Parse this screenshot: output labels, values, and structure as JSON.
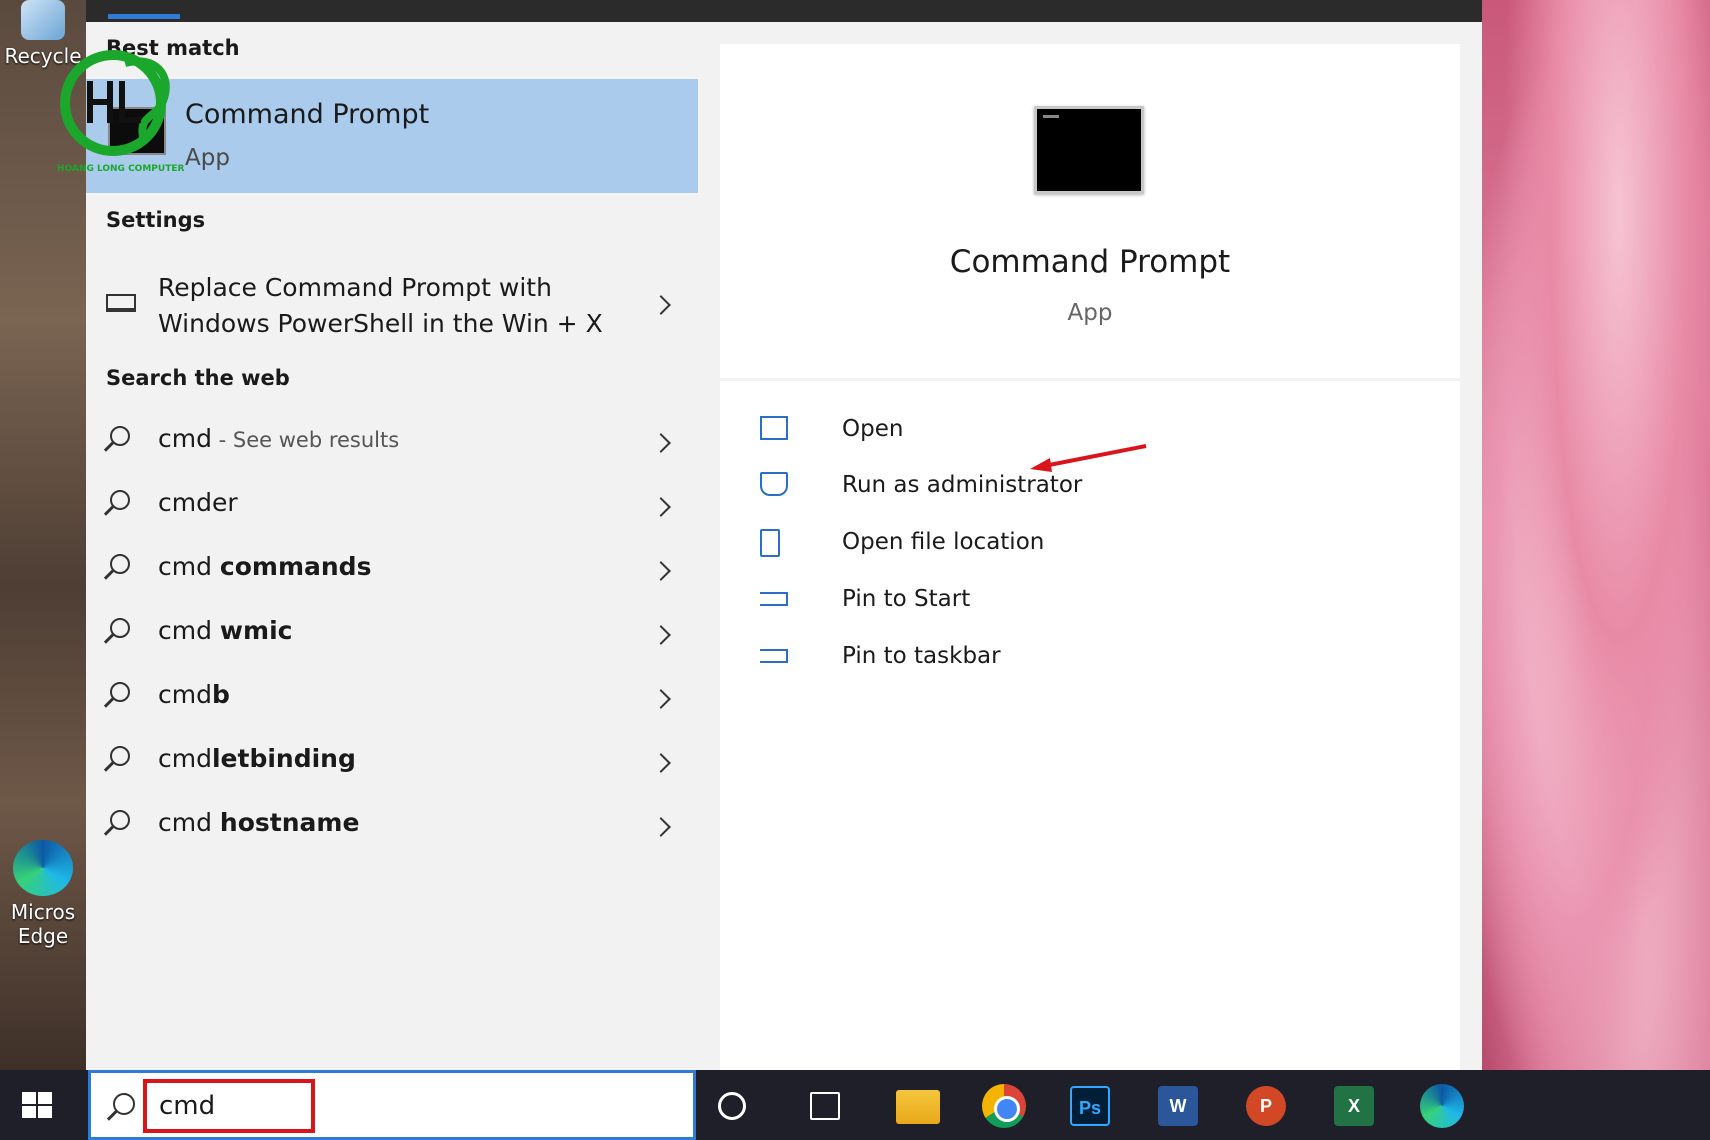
{
  "desktop": {
    "icons": [
      {
        "label": "Recycle"
      },
      {
        "label": "Micros Edge"
      }
    ]
  },
  "best_match": {
    "header": "Best match",
    "title": "Command Prompt",
    "subtitle": "App"
  },
  "logo_text": "HOANG LONG COMPUTER",
  "settings": {
    "header": "Settings",
    "item_line1": "Replace Command Prompt with",
    "item_line2": "Windows PowerShell in the Win + X"
  },
  "web": {
    "header": "Search the web",
    "items": [
      {
        "plain": "cmd",
        "bold": "",
        "suffix": " - See web results"
      },
      {
        "plain": "cmder",
        "bold": "",
        "suffix": ""
      },
      {
        "plain": "cmd ",
        "bold": "commands",
        "suffix": ""
      },
      {
        "plain": "cmd ",
        "bold": "wmic",
        "suffix": ""
      },
      {
        "plain": "cmd",
        "bold": "b",
        "suffix": ""
      },
      {
        "plain": "cmd",
        "bold": "letbinding",
        "suffix": ""
      },
      {
        "plain": "cmd ",
        "bold": "hostname",
        "suffix": ""
      }
    ]
  },
  "detail": {
    "title": "Command Prompt",
    "subtitle": "App",
    "actions": [
      {
        "label": "Open",
        "icon": "open-icon"
      },
      {
        "label": "Run as administrator",
        "icon": "shield-icon"
      },
      {
        "label": "Open file location",
        "icon": "file-location-icon"
      },
      {
        "label": "Pin to Start",
        "icon": "pin-icon"
      },
      {
        "label": "Pin to taskbar",
        "icon": "pin-icon"
      }
    ]
  },
  "taskbar": {
    "search_value": "cmd",
    "apps": [
      "Ps",
      "W",
      "P",
      "X"
    ]
  },
  "colors": {
    "accent": "#2f7bd6",
    "highlight": "#aacbec",
    "annotation_red": "#d9141b"
  }
}
